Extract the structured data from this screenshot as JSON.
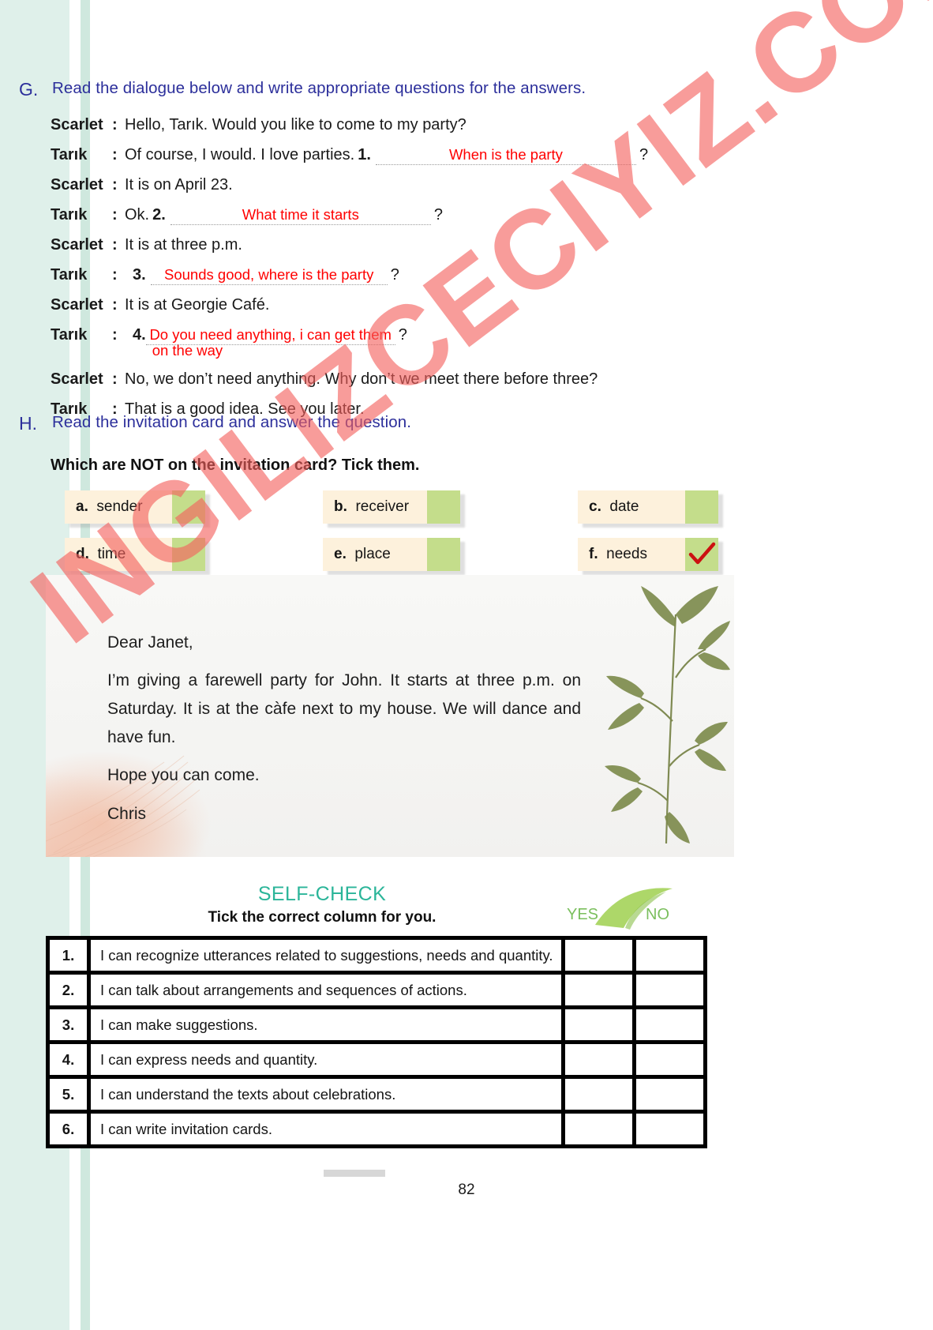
{
  "page": {
    "number": "82",
    "watermark": "INGILIZCECIYIZ.COM"
  },
  "section_g": {
    "letter": "G.",
    "instruction": "Read the dialogue below and write appropriate questions for the answers.",
    "lines": [
      {
        "speaker": "Scarlet",
        "colon": ":",
        "text": "Hello, Tarık. Would you like to come to my party?",
        "number": "",
        "answer": "",
        "answer_cont": "",
        "question_mark": ""
      },
      {
        "speaker": "Tarık",
        "colon": ":",
        "text": "Of course, I would. I love parties.",
        "number": "1.",
        "answer": "When is the party",
        "answer_cont": "",
        "question_mark": "?"
      },
      {
        "speaker": "Scarlet",
        "colon": ":",
        "text": "It is on April 23.",
        "number": "",
        "answer": "",
        "answer_cont": "",
        "question_mark": ""
      },
      {
        "speaker": "Tarık",
        "colon": ":",
        "text": "Ok.",
        "number": "2.",
        "answer": "What time it starts",
        "answer_cont": "",
        "question_mark": "?"
      },
      {
        "speaker": "Scarlet",
        "colon": ":",
        "text": "It is at three p.m.",
        "number": "",
        "answer": "",
        "answer_cont": "",
        "question_mark": ""
      },
      {
        "speaker": "Tarık",
        "colon": ":",
        "text": "",
        "number": "3.",
        "answer": "Sounds good, where is the party",
        "answer_cont": "",
        "question_mark": "?"
      },
      {
        "speaker": "Scarlet",
        "colon": ":",
        "text": "It is at Georgie Café.",
        "number": "",
        "answer": "",
        "answer_cont": "",
        "question_mark": ""
      },
      {
        "speaker": "Tarık",
        "colon": ":",
        "text": "",
        "number": "4.",
        "answer": "Do you need anything, i can get them",
        "answer_cont": "on the way",
        "question_mark": "?"
      },
      {
        "speaker": "Scarlet",
        "colon": ":",
        "text": "No, we don’t need anything. Why don’t we meet there before three?",
        "number": "",
        "answer": "",
        "answer_cont": "",
        "question_mark": ""
      },
      {
        "speaker": "Tarık",
        "colon": ":",
        "text": "That is a good idea. See you later.",
        "number": "",
        "answer": "",
        "answer_cont": "",
        "question_mark": ""
      }
    ]
  },
  "section_h": {
    "letter": "H.",
    "instruction": "Read the invitation card and answer the question.",
    "prompt": "Which are NOT on the invitation card? Tick them.",
    "options": [
      {
        "key": "a.",
        "label": "sender",
        "ticked": false
      },
      {
        "key": "b.",
        "label": "receiver",
        "ticked": false
      },
      {
        "key": "c.",
        "label": "date",
        "ticked": false
      },
      {
        "key": "d.",
        "label": "time",
        "ticked": false
      },
      {
        "key": "e.",
        "label": "place",
        "ticked": false
      },
      {
        "key": "f.",
        "label": "needs",
        "ticked": true
      }
    ],
    "card": {
      "greeting": "Dear Janet,",
      "body": "I’m giving a farewell party for John. It starts at three p.m. on Saturday. It is at the càfe next to my house. We will dance and have fun.",
      "closing": "Hope you can come.",
      "signature": "Chris"
    }
  },
  "self_check": {
    "title": "SELF-CHECK",
    "subtitle": "Tick the correct column for you.",
    "columns": {
      "yes": "YES",
      "no": "NO"
    },
    "rows": [
      {
        "num": "1.",
        "text": "I can recognize utterances related to suggestions, needs and quantity."
      },
      {
        "num": "2.",
        "text": "I can talk about arrangements and sequences of actions."
      },
      {
        "num": "3.",
        "text": "I can make suggestions."
      },
      {
        "num": "4.",
        "text": "I can express needs and quantity."
      },
      {
        "num": "5.",
        "text": "I can understand the texts about celebrations."
      },
      {
        "num": "6.",
        "text": "I can write invitation cards."
      }
    ]
  },
  "colors": {
    "heading_blue": "#2c2f9b",
    "ink_red": "#ff0000",
    "option_bg": "#fdf1dc",
    "option_box_green": "#c4dd8b",
    "selfcheck_teal": "#2bb599",
    "gutter_mint": "#dff0ea",
    "watermark_red": "#f4605c"
  }
}
